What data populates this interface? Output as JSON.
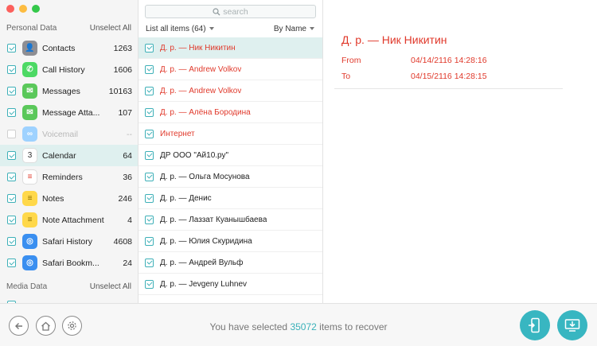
{
  "sidebar": {
    "personal_title": "Personal Data",
    "unselect_all": "Unselect All",
    "media_title": "Media Data",
    "media_unselect_all": "Unselect All",
    "items": [
      {
        "label": "Contacts",
        "count": "1263",
        "icon": "contacts-icon",
        "color": "#8e8e93",
        "glyph": "👤",
        "state": "checked"
      },
      {
        "label": "Call History",
        "count": "1606",
        "icon": "phone-icon",
        "color": "#4cd964",
        "glyph": "✆",
        "state": "checked"
      },
      {
        "label": "Messages",
        "count": "10163",
        "icon": "messages-icon",
        "color": "#5ac85a",
        "glyph": "✉",
        "state": "checked"
      },
      {
        "label": "Message Atta...",
        "count": "107",
        "icon": "message-attachment-icon",
        "color": "#5ac85a",
        "glyph": "✉",
        "state": "checked"
      },
      {
        "label": "Voicemail",
        "count": "--",
        "icon": "voicemail-icon",
        "color": "#9ed2ff",
        "glyph": "∞",
        "state": "disabled"
      },
      {
        "label": "Calendar",
        "count": "64",
        "icon": "calendar-icon",
        "color": "#ffffff",
        "glyph": "3",
        "state": "checked"
      },
      {
        "label": "Reminders",
        "count": "36",
        "icon": "reminders-icon",
        "color": "#ffffff",
        "glyph": "≡",
        "state": "checked"
      },
      {
        "label": "Notes",
        "count": "246",
        "icon": "notes-icon",
        "color": "#ffd84a",
        "glyph": "≡",
        "state": "checked"
      },
      {
        "label": "Note Attachment",
        "count": "4",
        "icon": "note-attachment-icon",
        "color": "#ffd84a",
        "glyph": "≡",
        "state": "checked"
      },
      {
        "label": "Safari History",
        "count": "4608",
        "icon": "safari-icon",
        "color": "#3a8ff0",
        "glyph": "◎",
        "state": "checked"
      },
      {
        "label": "Safari Bookm...",
        "count": "24",
        "icon": "safari-bookmark-icon",
        "color": "#3a8ff0",
        "glyph": "◎",
        "state": "checked"
      }
    ],
    "selected_index": 5
  },
  "list": {
    "search_placeholder": "search",
    "header_left": "List all items (64)",
    "header_right": "By Name",
    "rows": [
      {
        "text": "Д. р. — Ник Никитин",
        "red": true
      },
      {
        "text": "Д. р. — Andrew Volkov",
        "red": true
      },
      {
        "text": "Д. р. — Andrew Volkov",
        "red": true
      },
      {
        "text": "Д. р. — Алёна Бородина",
        "red": true
      },
      {
        "text": "Интернет",
        "red": true
      },
      {
        "text": "ДР ООО \"Ай10.ру\"",
        "red": false
      },
      {
        "text": "Д. р. — Ольга Мосунова",
        "red": false
      },
      {
        "text": "Д. р. — Денис",
        "red": false
      },
      {
        "text": "Д. р. — Лаззат Куанышбаева",
        "red": false
      },
      {
        "text": "Д. р. — Юлия Скуридина",
        "red": false
      },
      {
        "text": "Д. р. — Андрей Вульф",
        "red": false
      },
      {
        "text": "Д. р. — Jevgeny Luhnev",
        "red": false
      }
    ],
    "selected_index": 0
  },
  "detail": {
    "title": "Д. р. — Ник Никитин",
    "from_label": "From",
    "from_value": "04/14/2116 14:28:16",
    "to_label": "To",
    "to_value": "04/15/2116 14:28:15"
  },
  "footer": {
    "status_prefix": "You have selected ",
    "status_count": "35072",
    "status_suffix": " items to recover"
  },
  "colors": {
    "accent": "#3ab1b9",
    "alert_red": "#e0392b",
    "selection_bg": "#dff0ef"
  }
}
